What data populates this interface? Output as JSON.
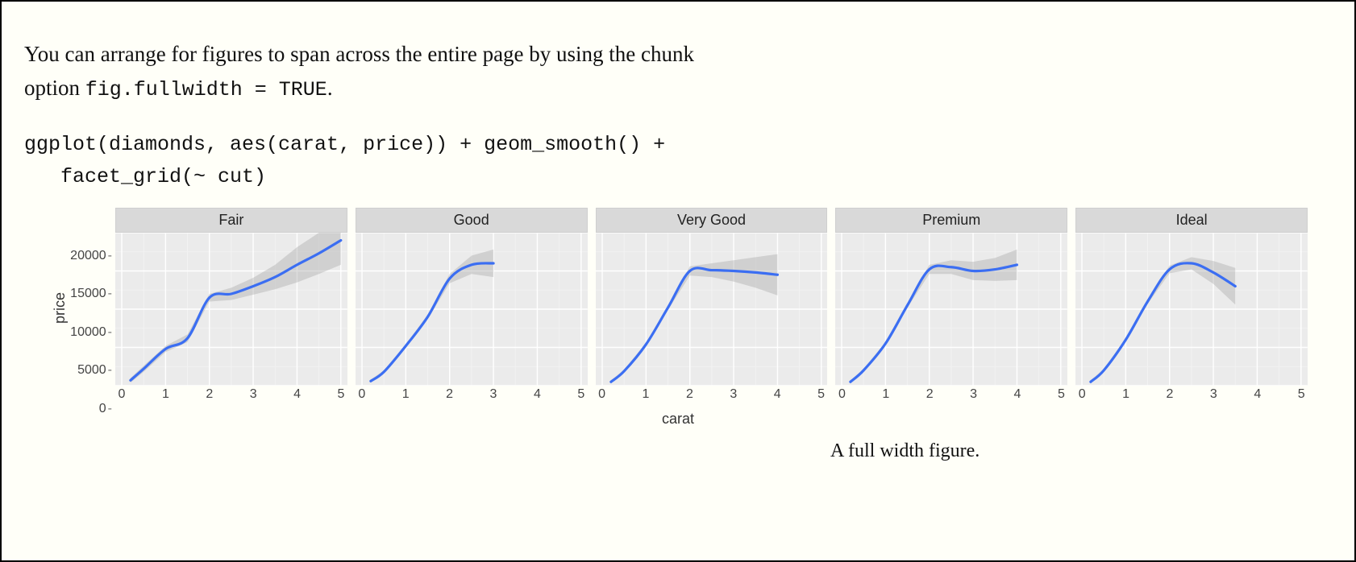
{
  "body_text_pre": "You can arrange for figures to span across the entire page by using the chunk option ",
  "body_code": "fig.fullwidth = TRUE",
  "body_text_post": ".",
  "code_block": "ggplot(diamonds, aes(carat, price)) + geom_smooth() +\n   facet_grid(~ cut)",
  "caption": "A full width figure.",
  "chart_data": {
    "type": "line",
    "xlabel": "carat",
    "ylabel": "price",
    "xlim": [
      0,
      5
    ],
    "ylim": [
      0,
      20000
    ],
    "x_ticks": [
      0,
      1,
      2,
      3,
      4,
      5
    ],
    "y_ticks": [
      0,
      5000,
      10000,
      15000,
      20000
    ],
    "facets": [
      {
        "name": "Fair",
        "x": [
          0.2,
          0.5,
          1.0,
          1.5,
          2.0,
          2.5,
          3.0,
          3.5,
          4.0,
          4.5,
          5.0
        ],
        "y": [
          700,
          2200,
          4800,
          6200,
          11500,
          12000,
          13000,
          14200,
          15800,
          17300,
          19000
        ],
        "se_low": [
          400,
          1800,
          4400,
          5700,
          11000,
          11200,
          11900,
          12600,
          13500,
          14600,
          15800
        ],
        "se_high": [
          1000,
          2600,
          5200,
          6700,
          12000,
          12800,
          14100,
          15800,
          18100,
          20000,
          22200
        ]
      },
      {
        "name": "Good",
        "x": [
          0.2,
          0.5,
          1.0,
          1.5,
          2.0,
          2.5,
          3.0
        ],
        "y": [
          600,
          1800,
          5200,
          9000,
          14000,
          15800,
          16000
        ],
        "se_low": [
          400,
          1600,
          5000,
          8700,
          13400,
          14600,
          14200
        ],
        "se_high": [
          800,
          2000,
          5400,
          9300,
          14600,
          17000,
          17800
        ]
      },
      {
        "name": "Very Good",
        "x": [
          0.2,
          0.5,
          1.0,
          1.5,
          2.0,
          2.5,
          3.0,
          3.5,
          4.0
        ],
        "y": [
          500,
          1900,
          5400,
          10200,
          15000,
          15100,
          15000,
          14800,
          14500
        ],
        "se_low": [
          300,
          1700,
          5200,
          9900,
          14400,
          14200,
          13600,
          12800,
          11800
        ],
        "se_high": [
          700,
          2100,
          5600,
          10500,
          15600,
          16000,
          16400,
          16800,
          17200
        ]
      },
      {
        "name": "Premium",
        "x": [
          0.2,
          0.5,
          1.0,
          1.5,
          2.0,
          2.5,
          3.0,
          3.5,
          4.0
        ],
        "y": [
          500,
          2000,
          5500,
          10500,
          15200,
          15500,
          15000,
          15200,
          15800
        ],
        "se_low": [
          300,
          1800,
          5300,
          10200,
          14600,
          14600,
          13800,
          13700,
          13800
        ],
        "se_high": [
          700,
          2200,
          5700,
          10800,
          15800,
          16400,
          16200,
          16700,
          17800
        ]
      },
      {
        "name": "Ideal",
        "x": [
          0.2,
          0.5,
          1.0,
          1.5,
          2.0,
          2.5,
          3.0,
          3.5
        ],
        "y": [
          500,
          2000,
          6000,
          11000,
          15200,
          16000,
          14800,
          13000
        ],
        "se_low": [
          300,
          1800,
          5800,
          10700,
          14700,
          15200,
          13300,
          10600
        ],
        "se_high": [
          700,
          2200,
          6200,
          11300,
          15700,
          16800,
          16300,
          15400
        ]
      }
    ]
  }
}
